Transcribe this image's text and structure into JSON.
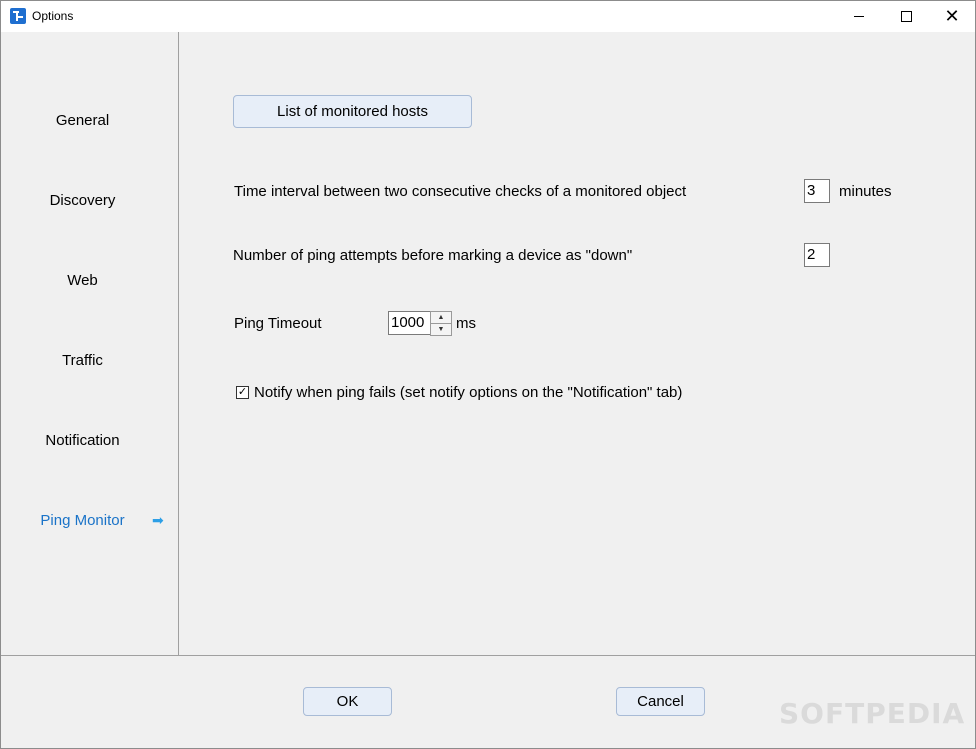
{
  "window": {
    "title": "Options",
    "minimize_glyph": "",
    "close_glyph": "✕"
  },
  "sidebar": {
    "items": [
      {
        "label": "General"
      },
      {
        "label": "Discovery"
      },
      {
        "label": "Web"
      },
      {
        "label": "Traffic"
      },
      {
        "label": "Notification"
      },
      {
        "label": "Ping Monitor",
        "active": true
      }
    ],
    "active_arrow_icon": "arrow-right-icon",
    "active_arrow_glyph": "➡",
    "active_color": "#1a73c8"
  },
  "ping_monitor": {
    "list_hosts_button": "List of monitored hosts",
    "interval_label": "Time interval between two consecutive checks of a monitored object",
    "interval_value": "3",
    "interval_unit": "minutes",
    "attempts_label": "Number of ping attempts before marking a device as \"down\"",
    "attempts_value": "2",
    "timeout_label": "Ping Timeout",
    "timeout_value": "1000",
    "timeout_unit": "ms",
    "spin_up_glyph": "▲",
    "spin_down_glyph": "▼",
    "notify_checked": true,
    "notify_check_glyph": "✓",
    "notify_label": "Notify when ping fails (set notify options on the \"Notification\" tab)"
  },
  "footer": {
    "ok_label": "OK",
    "cancel_label": "Cancel"
  },
  "watermark": "SOFTPEDIA"
}
